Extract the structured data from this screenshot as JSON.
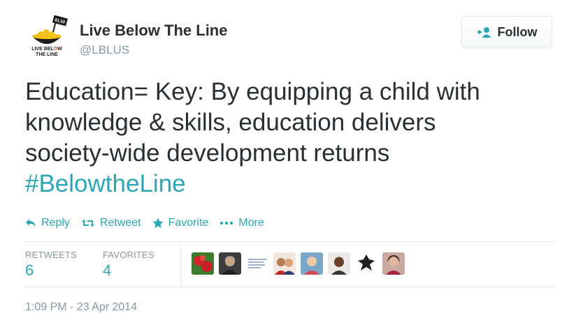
{
  "user": {
    "display_name": "Live Below The Line",
    "screen_name": "@LBLUS",
    "avatar_logo_text": "LIVE BELOW THE LINE",
    "avatar_badge_text": "$1.50"
  },
  "follow_button": {
    "label": "Follow",
    "icon": "add-user-icon"
  },
  "tweet": {
    "lines": [
      "Education= Key: By equipping a child with",
      "knowledge & skills, education delivers",
      "society-wide development returns"
    ],
    "hashtag": "#BelowtheLine"
  },
  "actions": [
    {
      "label": "Reply",
      "icon": "reply-icon"
    },
    {
      "label": "Retweet",
      "icon": "retweet-icon"
    },
    {
      "label": "Favorite",
      "icon": "star-icon"
    },
    {
      "label": "More",
      "icon": "more-dots-icon"
    }
  ],
  "stats": {
    "retweets_label": "RETWEETS",
    "retweets_value": "6",
    "favorites_label": "FAVORITES",
    "favorites_value": "4"
  },
  "timestamp": "1:09 PM - 23 Apr 2014",
  "colors": {
    "accent": "#2aa8b3",
    "text": "#292f33",
    "muted": "#8899a6",
    "border": "#e1e8ed"
  }
}
